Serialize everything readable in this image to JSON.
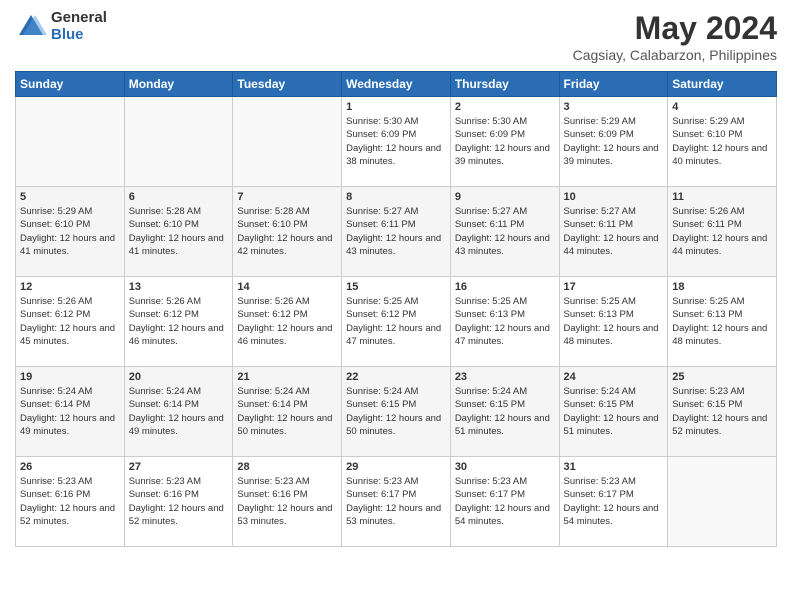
{
  "header": {
    "logo_general": "General",
    "logo_blue": "Blue",
    "title": "May 2024",
    "subtitle": "Cagsiay, Calabarzon, Philippines"
  },
  "days_of_week": [
    "Sunday",
    "Monday",
    "Tuesday",
    "Wednesday",
    "Thursday",
    "Friday",
    "Saturday"
  ],
  "weeks": [
    [
      {
        "num": "",
        "sunrise": "",
        "sunset": "",
        "daylight": ""
      },
      {
        "num": "",
        "sunrise": "",
        "sunset": "",
        "daylight": ""
      },
      {
        "num": "",
        "sunrise": "",
        "sunset": "",
        "daylight": ""
      },
      {
        "num": "1",
        "sunrise": "Sunrise: 5:30 AM",
        "sunset": "Sunset: 6:09 PM",
        "daylight": "Daylight: 12 hours and 38 minutes."
      },
      {
        "num": "2",
        "sunrise": "Sunrise: 5:30 AM",
        "sunset": "Sunset: 6:09 PM",
        "daylight": "Daylight: 12 hours and 39 minutes."
      },
      {
        "num": "3",
        "sunrise": "Sunrise: 5:29 AM",
        "sunset": "Sunset: 6:09 PM",
        "daylight": "Daylight: 12 hours and 39 minutes."
      },
      {
        "num": "4",
        "sunrise": "Sunrise: 5:29 AM",
        "sunset": "Sunset: 6:10 PM",
        "daylight": "Daylight: 12 hours and 40 minutes."
      }
    ],
    [
      {
        "num": "5",
        "sunrise": "Sunrise: 5:29 AM",
        "sunset": "Sunset: 6:10 PM",
        "daylight": "Daylight: 12 hours and 41 minutes."
      },
      {
        "num": "6",
        "sunrise": "Sunrise: 5:28 AM",
        "sunset": "Sunset: 6:10 PM",
        "daylight": "Daylight: 12 hours and 41 minutes."
      },
      {
        "num": "7",
        "sunrise": "Sunrise: 5:28 AM",
        "sunset": "Sunset: 6:10 PM",
        "daylight": "Daylight: 12 hours and 42 minutes."
      },
      {
        "num": "8",
        "sunrise": "Sunrise: 5:27 AM",
        "sunset": "Sunset: 6:11 PM",
        "daylight": "Daylight: 12 hours and 43 minutes."
      },
      {
        "num": "9",
        "sunrise": "Sunrise: 5:27 AM",
        "sunset": "Sunset: 6:11 PM",
        "daylight": "Daylight: 12 hours and 43 minutes."
      },
      {
        "num": "10",
        "sunrise": "Sunrise: 5:27 AM",
        "sunset": "Sunset: 6:11 PM",
        "daylight": "Daylight: 12 hours and 44 minutes."
      },
      {
        "num": "11",
        "sunrise": "Sunrise: 5:26 AM",
        "sunset": "Sunset: 6:11 PM",
        "daylight": "Daylight: 12 hours and 44 minutes."
      }
    ],
    [
      {
        "num": "12",
        "sunrise": "Sunrise: 5:26 AM",
        "sunset": "Sunset: 6:12 PM",
        "daylight": "Daylight: 12 hours and 45 minutes."
      },
      {
        "num": "13",
        "sunrise": "Sunrise: 5:26 AM",
        "sunset": "Sunset: 6:12 PM",
        "daylight": "Daylight: 12 hours and 46 minutes."
      },
      {
        "num": "14",
        "sunrise": "Sunrise: 5:26 AM",
        "sunset": "Sunset: 6:12 PM",
        "daylight": "Daylight: 12 hours and 46 minutes."
      },
      {
        "num": "15",
        "sunrise": "Sunrise: 5:25 AM",
        "sunset": "Sunset: 6:12 PM",
        "daylight": "Daylight: 12 hours and 47 minutes."
      },
      {
        "num": "16",
        "sunrise": "Sunrise: 5:25 AM",
        "sunset": "Sunset: 6:13 PM",
        "daylight": "Daylight: 12 hours and 47 minutes."
      },
      {
        "num": "17",
        "sunrise": "Sunrise: 5:25 AM",
        "sunset": "Sunset: 6:13 PM",
        "daylight": "Daylight: 12 hours and 48 minutes."
      },
      {
        "num": "18",
        "sunrise": "Sunrise: 5:25 AM",
        "sunset": "Sunset: 6:13 PM",
        "daylight": "Daylight: 12 hours and 48 minutes."
      }
    ],
    [
      {
        "num": "19",
        "sunrise": "Sunrise: 5:24 AM",
        "sunset": "Sunset: 6:14 PM",
        "daylight": "Daylight: 12 hours and 49 minutes."
      },
      {
        "num": "20",
        "sunrise": "Sunrise: 5:24 AM",
        "sunset": "Sunset: 6:14 PM",
        "daylight": "Daylight: 12 hours and 49 minutes."
      },
      {
        "num": "21",
        "sunrise": "Sunrise: 5:24 AM",
        "sunset": "Sunset: 6:14 PM",
        "daylight": "Daylight: 12 hours and 50 minutes."
      },
      {
        "num": "22",
        "sunrise": "Sunrise: 5:24 AM",
        "sunset": "Sunset: 6:15 PM",
        "daylight": "Daylight: 12 hours and 50 minutes."
      },
      {
        "num": "23",
        "sunrise": "Sunrise: 5:24 AM",
        "sunset": "Sunset: 6:15 PM",
        "daylight": "Daylight: 12 hours and 51 minutes."
      },
      {
        "num": "24",
        "sunrise": "Sunrise: 5:24 AM",
        "sunset": "Sunset: 6:15 PM",
        "daylight": "Daylight: 12 hours and 51 minutes."
      },
      {
        "num": "25",
        "sunrise": "Sunrise: 5:23 AM",
        "sunset": "Sunset: 6:15 PM",
        "daylight": "Daylight: 12 hours and 52 minutes."
      }
    ],
    [
      {
        "num": "26",
        "sunrise": "Sunrise: 5:23 AM",
        "sunset": "Sunset: 6:16 PM",
        "daylight": "Daylight: 12 hours and 52 minutes."
      },
      {
        "num": "27",
        "sunrise": "Sunrise: 5:23 AM",
        "sunset": "Sunset: 6:16 PM",
        "daylight": "Daylight: 12 hours and 52 minutes."
      },
      {
        "num": "28",
        "sunrise": "Sunrise: 5:23 AM",
        "sunset": "Sunset: 6:16 PM",
        "daylight": "Daylight: 12 hours and 53 minutes."
      },
      {
        "num": "29",
        "sunrise": "Sunrise: 5:23 AM",
        "sunset": "Sunset: 6:17 PM",
        "daylight": "Daylight: 12 hours and 53 minutes."
      },
      {
        "num": "30",
        "sunrise": "Sunrise: 5:23 AM",
        "sunset": "Sunset: 6:17 PM",
        "daylight": "Daylight: 12 hours and 54 minutes."
      },
      {
        "num": "31",
        "sunrise": "Sunrise: 5:23 AM",
        "sunset": "Sunset: 6:17 PM",
        "daylight": "Daylight: 12 hours and 54 minutes."
      },
      {
        "num": "",
        "sunrise": "",
        "sunset": "",
        "daylight": ""
      }
    ]
  ]
}
